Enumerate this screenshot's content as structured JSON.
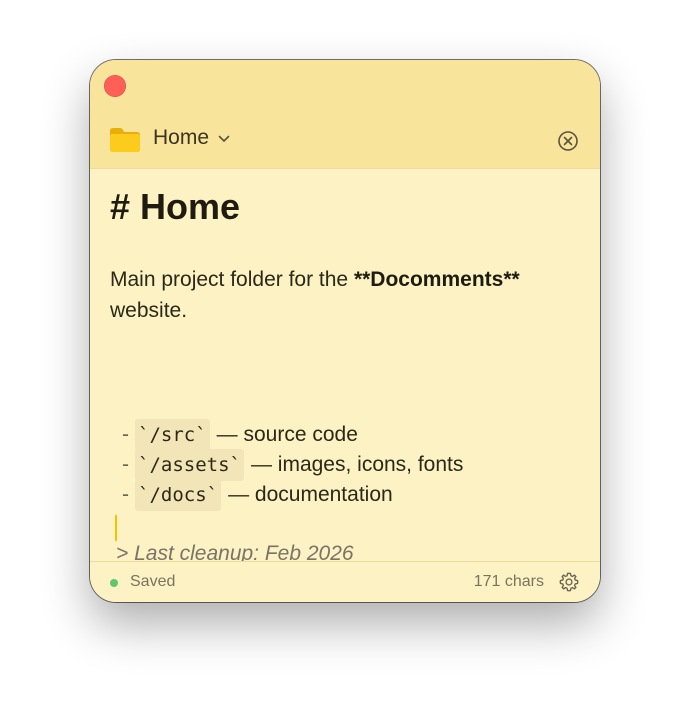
{
  "window": {
    "folder_name": "Home",
    "folder_icon": "folder-icon",
    "accent_color": "#f8e59b",
    "background_color": "#fcf2c4"
  },
  "note": {
    "heading": "# Home",
    "paragraph_prefix": "Main project folder for the ",
    "paragraph_bold": "**Docomments**",
    "paragraph_suffix": " website.",
    "list_items": [
      {
        "bullet": "-",
        "code": "`/src`",
        "text": "— source code"
      },
      {
        "bullet": "-",
        "code": "`/assets`",
        "text": "— images, icons, fonts"
      },
      {
        "bullet": "-",
        "code": "`/docs`",
        "text": "— documentation"
      }
    ],
    "quote": "> Last cleanup: Feb 2026"
  },
  "status": {
    "saved_label": "Saved",
    "saved_color": "#5ec86e",
    "char_count": "171 chars"
  }
}
